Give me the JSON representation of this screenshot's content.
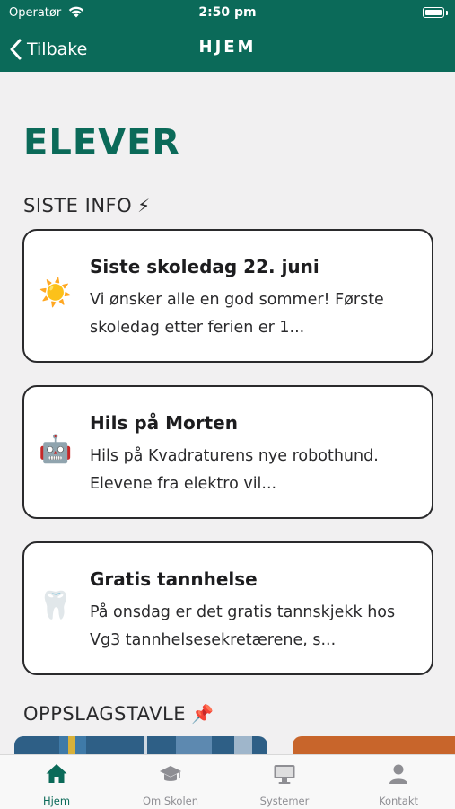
{
  "status_bar": {
    "carrier": "Operatør",
    "time": "2:50 pm"
  },
  "nav": {
    "back_label": "Tilbake",
    "title": "HJEM"
  },
  "page_title": "ELEVER",
  "latest_info": {
    "title": "SISTE INFO",
    "title_emoji": "⚡",
    "cards": [
      {
        "icon": "☀️",
        "title": "Siste skoledag 22. juni",
        "body": "Vi ønsker alle en god sommer! Første skoledag etter ferien er 1..."
      },
      {
        "icon": "🤖",
        "title": "Hils på Morten",
        "body": "Hils på Kvadraturens nye robothund. Elevene fra elektro vil..."
      },
      {
        "icon": "🦷",
        "title": "Gratis tannhelse",
        "body": "På onsdag er det gratis tannskjekk hos Vg3 tannhelsesekretærene, s..."
      }
    ]
  },
  "bulletin": {
    "title": "OPPSLAGSTAVLE",
    "title_emoji": "📌"
  },
  "tabs": [
    {
      "label": "Hjem",
      "icon": "home-icon",
      "active": true
    },
    {
      "label": "Om Skolen",
      "icon": "graduation-cap-icon",
      "active": false
    },
    {
      "label": "Systemer",
      "icon": "monitor-icon",
      "active": false
    },
    {
      "label": "Kontakt",
      "icon": "person-icon",
      "active": false
    }
  ],
  "colors": {
    "brand": "#0b6a59",
    "background": "#f1f0f1",
    "tab_inactive": "#8e8e93"
  }
}
